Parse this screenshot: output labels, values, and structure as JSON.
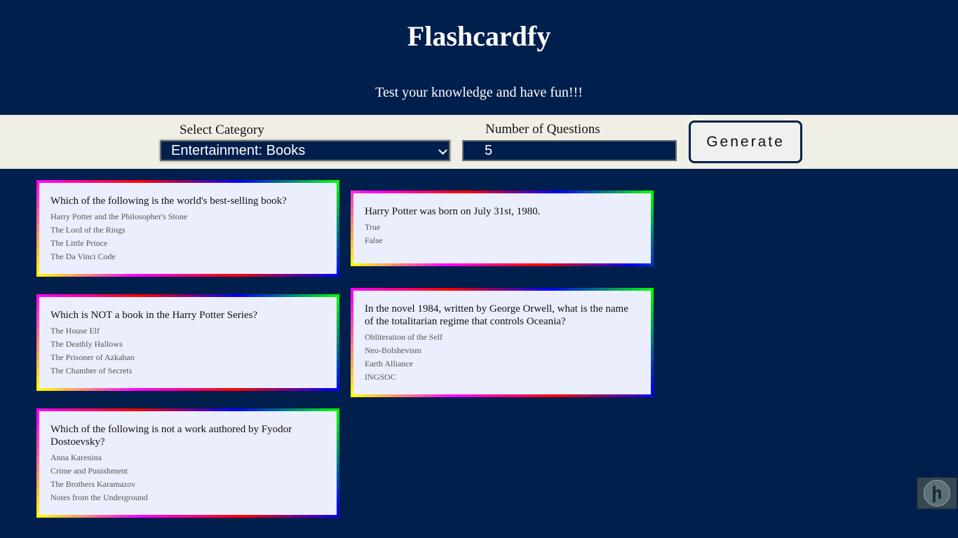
{
  "header": {
    "title": "Flashcardfy",
    "subtitle": "Test your knowledge and have fun!!!"
  },
  "controls": {
    "category_label": "Select Category",
    "category_value": "Entertainment: Books",
    "questions_label": "Number of Questions",
    "questions_value": "5",
    "generate_label": "Generate"
  },
  "cards": [
    {
      "question": "Which of the following is the world's best-selling book?",
      "answers": [
        "Harry Potter and the Philosopher's Stone",
        "The Lord of the Rings",
        "The Little Prince",
        "The Da Vinci Code"
      ]
    },
    {
      "question": "Harry Potter was born on July 31st, 1980.",
      "answers": [
        "True",
        "False"
      ]
    },
    {
      "question": "Which is NOT a book in the Harry Potter Series?",
      "answers": [
        "The House Elf",
        "The Deathly Hallows",
        "The Prisoner of Azkaban",
        "The Chamber of Secrets"
      ]
    },
    {
      "question": "In the novel 1984, written by George Orwell, what is the name of the totalitarian regime that controls Oceania?",
      "answers": [
        "Obliteration of the Self",
        "Neo-Bolshevism",
        "Earth Alliance",
        "INGSOC"
      ]
    },
    {
      "question": "Which of the following is not a work authored by Fyodor Dostoevsky?",
      "answers": [
        "Anna Karenina",
        "Crime and Punishment",
        "The Brothers Karamazov",
        "Notes from the Underground"
      ]
    }
  ],
  "floating_button": {
    "icon": "assistant-icon"
  },
  "colors": {
    "background": "#001f4d",
    "controls_bar": "#f0efe5",
    "card_background": "#ebeefc",
    "card_border_gradient": [
      "#ffff00",
      "#ff00ff",
      "#ff0000",
      "#0000ff",
      "#00ff00"
    ]
  }
}
